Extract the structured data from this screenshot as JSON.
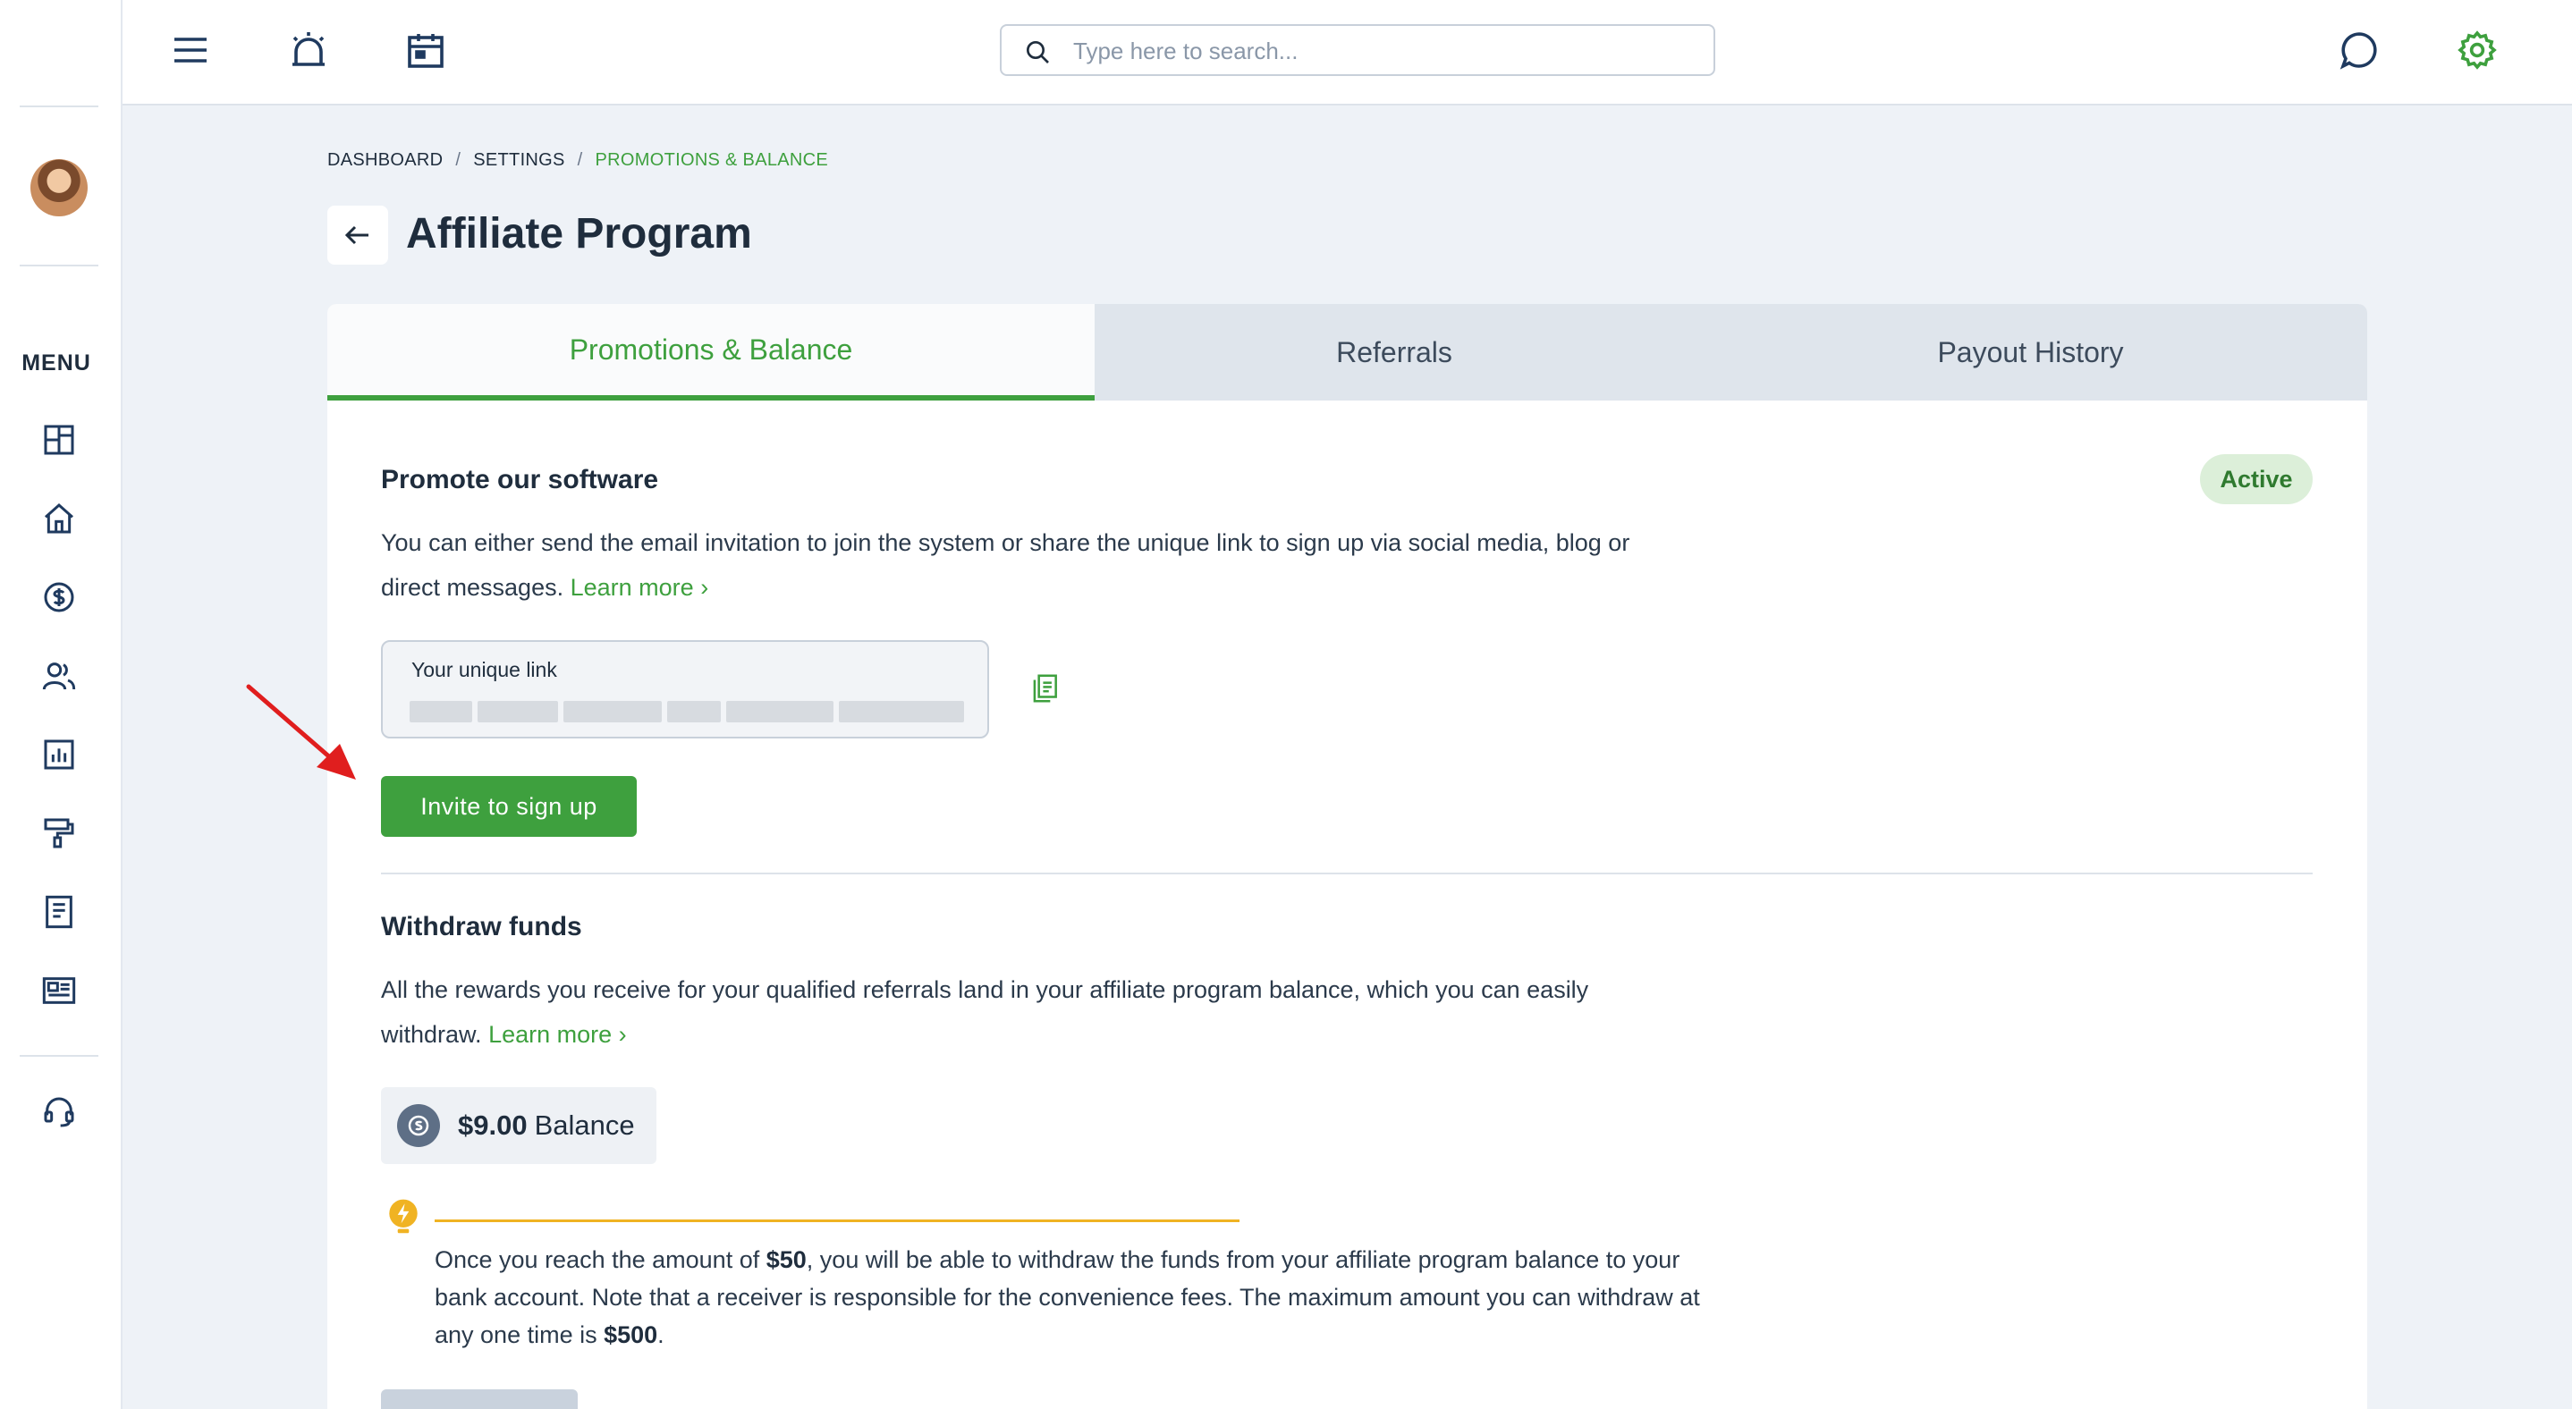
{
  "topbar": {
    "search_placeholder": "Type here to search..."
  },
  "sidebar": {
    "menu_label": "MENU"
  },
  "breadcrumb": {
    "items": [
      "DASHBOARD",
      "SETTINGS",
      "PROMOTIONS & BALANCE"
    ],
    "separator": "/"
  },
  "page": {
    "title": "Affiliate Program"
  },
  "tabs": [
    {
      "label": "Promotions & Balance",
      "active": true
    },
    {
      "label": "Referrals",
      "active": false
    },
    {
      "label": "Payout History",
      "active": false
    }
  ],
  "promote": {
    "title": "Promote our software",
    "status": "Active",
    "description": "You can either send the email invitation to join the system or share the unique link to sign up via social media, blog or direct messages.",
    "learn_more": "Learn more",
    "link_label": "Your unique link",
    "invite_button": "Invite to sign up"
  },
  "withdraw": {
    "title": "Withdraw funds",
    "description": "All the rewards you receive for your qualified referrals land in your affiliate program balance, which you can easily withdraw.",
    "learn_more": "Learn more",
    "balance_amount": "$9.00",
    "balance_label": "Balance",
    "tip_part1": "Once you reach the amount of ",
    "tip_min": "$50",
    "tip_part2": ", you will be able to withdraw the funds from your affiliate program balance to your bank account. Note that a receiver is responsible for the convenience fees. The maximum amount you can withdraw at any one time is ",
    "tip_max": "$500",
    "tip_part3": "."
  },
  "colors": {
    "accent_green": "#3ea03e",
    "active_badge_bg": "#dcefd9",
    "tip_yellow": "#f0b323",
    "annotation_red": "#e01e1e"
  },
  "icons": {
    "topbar": [
      "hamburger-menu-icon",
      "alarm-icon",
      "calendar-icon",
      "chat-icon",
      "gear-icon"
    ],
    "sidebar": [
      "dashboard-icon",
      "home-icon",
      "dollar-icon",
      "users-icon",
      "chart-icon",
      "paint-roller-icon",
      "document-icon",
      "news-icon",
      "headset-icon"
    ]
  }
}
